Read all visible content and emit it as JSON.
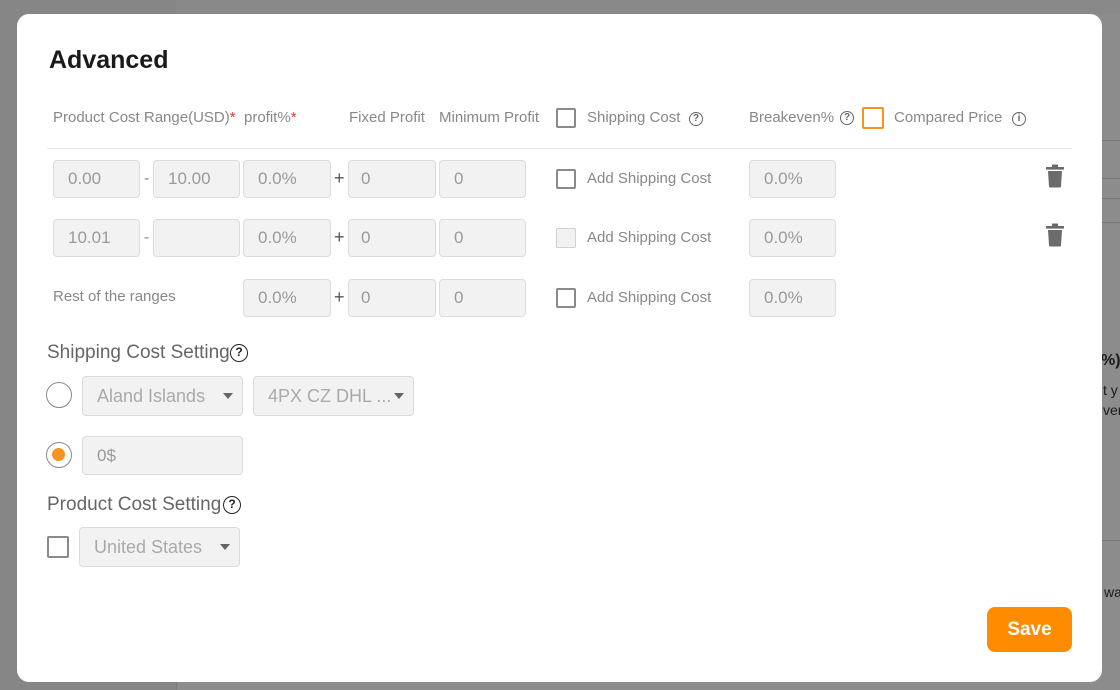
{
  "background": {
    "fragment_pct": "%)",
    "fragment_t": "t y",
    "fragment_ver": "ver",
    "fragment_wa": "wa"
  },
  "modal": {
    "title": "Advanced",
    "headers": {
      "cost_range": "Product Cost Range(USD)",
      "profit_pct": "profit%",
      "required_mark": "*",
      "fixed_profit": "Fixed Profit",
      "minimum_profit": "Minimum Profit",
      "shipping_cost": "Shipping Cost",
      "breakeven": "Breakeven%",
      "compared_price": "Compared Price"
    },
    "separators": {
      "dash": "-",
      "plus": "+"
    },
    "rows": [
      {
        "min": "0.00",
        "max": "10.00",
        "profit": "0.0%",
        "fixed": "0",
        "minimum": "0",
        "shipping_label": "Add Shipping Cost",
        "breakeven": "0.0%"
      },
      {
        "min": "10.01",
        "max": "",
        "profit": "0.0%",
        "fixed": "0",
        "minimum": "0",
        "shipping_label": "Add Shipping Cost",
        "breakeven": "0.0%"
      },
      {
        "label": "Rest of the ranges",
        "profit": "0.0%",
        "fixed": "0",
        "minimum": "0",
        "shipping_label": "Add Shipping Cost",
        "breakeven": "0.0%"
      }
    ],
    "shipping_setting": {
      "title": "Shipping Cost Setting",
      "country": "Aland Islands",
      "method": "4PX CZ DHL ...",
      "fixed_value": "0$"
    },
    "product_cost_setting": {
      "title": "Product Cost Setting",
      "country": "United States"
    },
    "save_label": "Save",
    "colors": {
      "accent": "#ff8c00",
      "required": "#e53935"
    }
  }
}
